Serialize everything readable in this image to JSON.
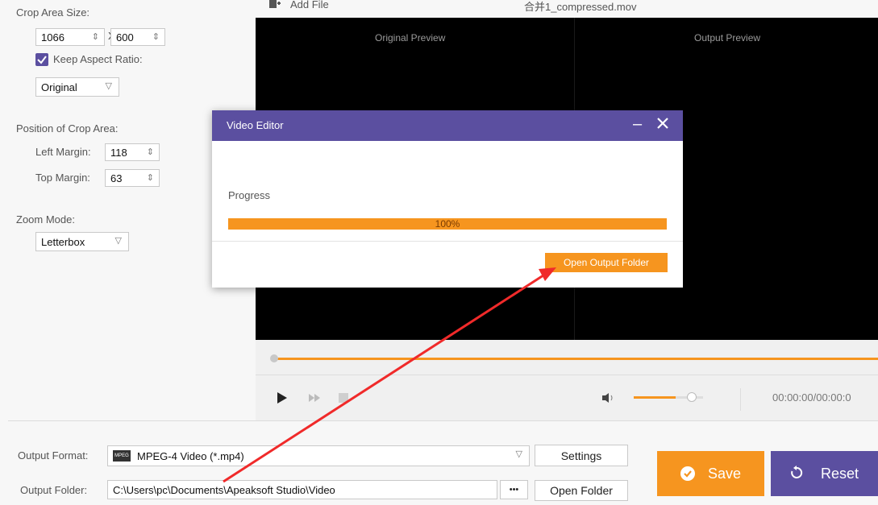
{
  "left_panel": {
    "crop_area_size_label": "Crop Area Size:",
    "width_value": "1066",
    "x_label": "X",
    "height_value": "600",
    "keep_aspect_label": "Keep Aspect Ratio:",
    "aspect_value": "Original",
    "position_label": "Position of Crop Area:",
    "left_margin_label": "Left Margin:",
    "left_margin_value": "118",
    "top_margin_label": "Top Margin:",
    "top_margin_value": "63",
    "zoom_mode_label": "Zoom Mode:",
    "zoom_mode_value": "Letterbox"
  },
  "topbar": {
    "add_file_label": "Add File",
    "file_name": "合并1_compressed.mov"
  },
  "preview": {
    "original_label": "Original Preview",
    "output_label": "Output Preview",
    "time_display": "00:00:00/00:00:0",
    "seek_progress": 0.0,
    "volume_level": 0.6
  },
  "dialog": {
    "title": "Video Editor",
    "progress_label": "Progress",
    "progress_value": 100,
    "progress_text": "100%",
    "open_output_folder_label": "Open Output Folder"
  },
  "bottom": {
    "output_format_label": "Output Format:",
    "output_format_icon_text": "MPEG",
    "output_format_value": "MPEG-4 Video (*.mp4)",
    "settings_label": "Settings",
    "output_folder_label": "Output Folder:",
    "output_folder_value": "C:\\Users\\pc\\Documents\\Apeaksoft Studio\\Video",
    "browse_label": "•••",
    "open_folder_label": "Open Folder",
    "save_label": "Save",
    "reset_label": "Reset"
  },
  "colors": {
    "accent_orange": "#f6951f",
    "accent_purple": "#5b4fa0",
    "annotation_red": "#f02a2a"
  }
}
